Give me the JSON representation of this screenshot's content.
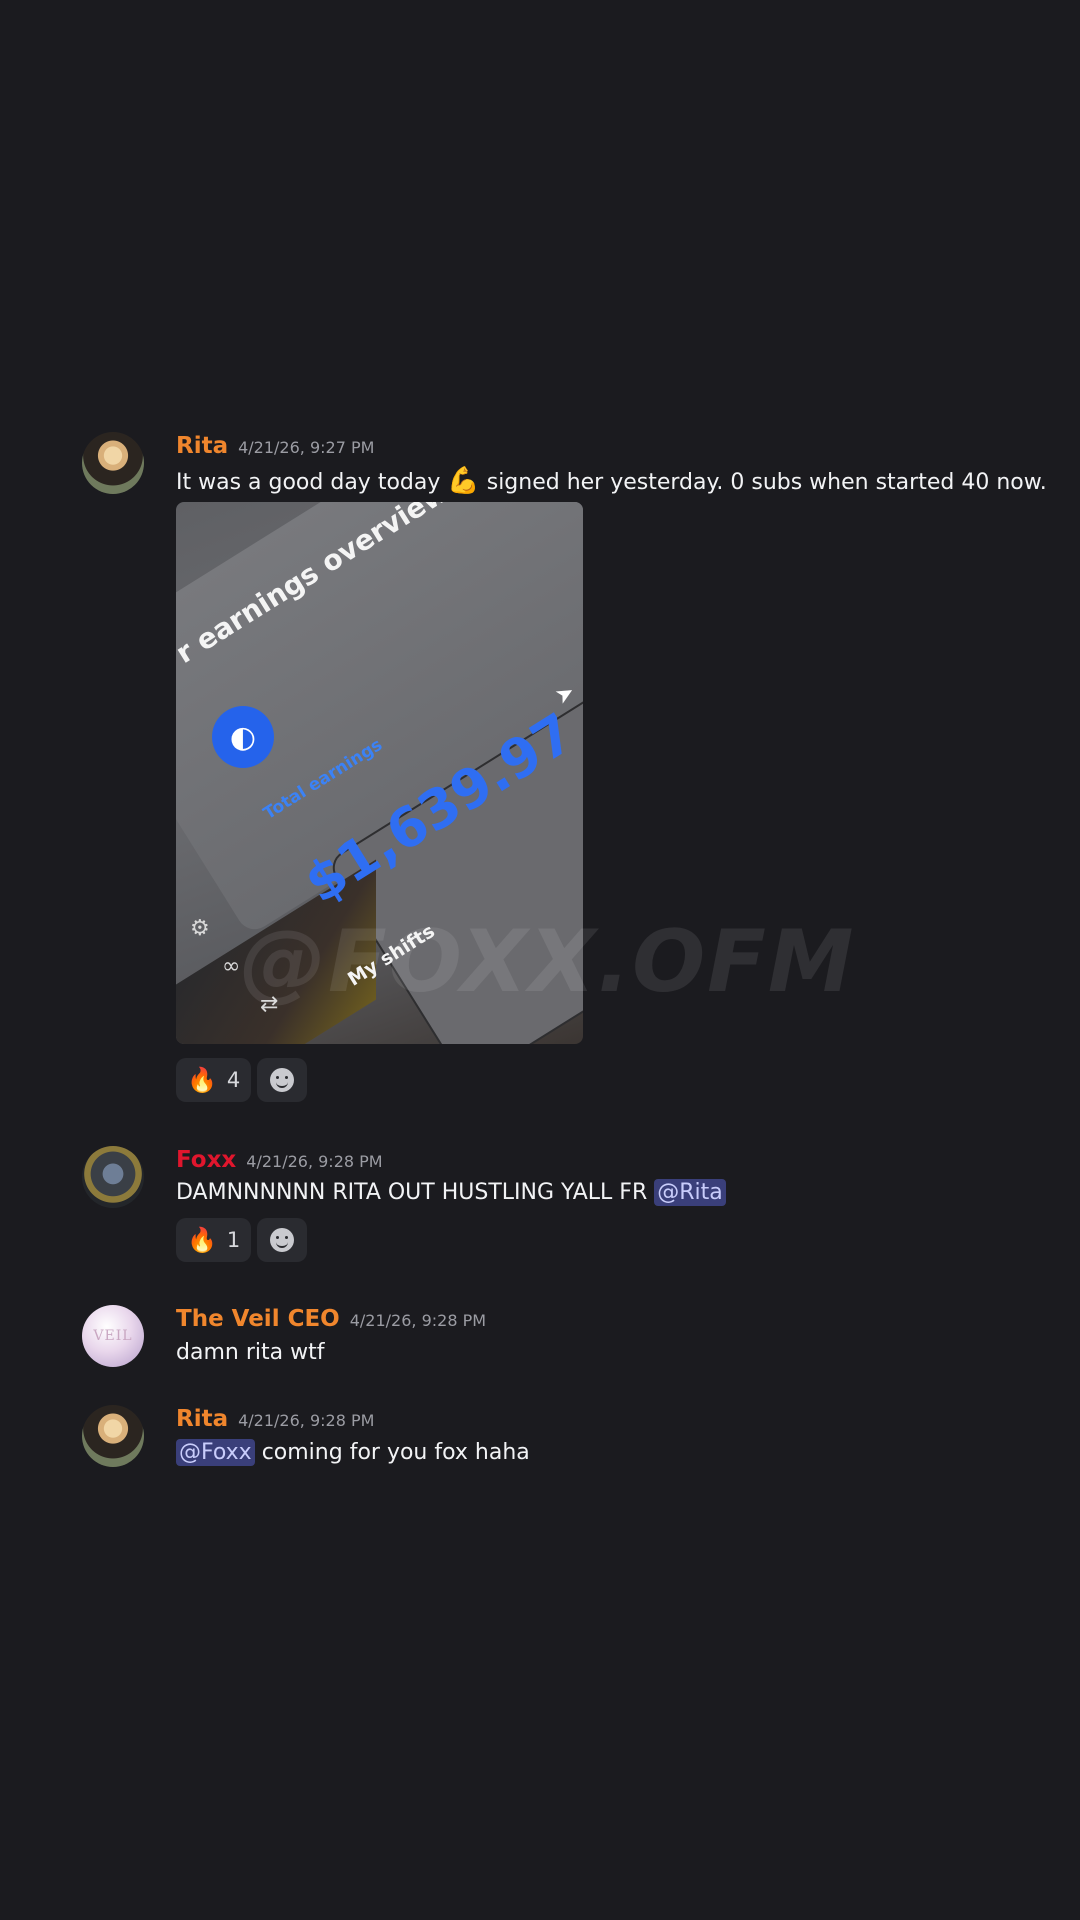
{
  "messages": [
    {
      "author": "Rita",
      "timestamp": "4/21/26, 9:27 PM",
      "text_before": "It was a good day today ",
      "emoji": "💪",
      "text_after": " signed her yesterday. 0 subs when started 40 now.",
      "attachment": {
        "title": "r earnings overview",
        "total_label": "Total earnings",
        "total_value": "$1,639.97",
        "shifts_label": "My shifts"
      },
      "reactions": [
        {
          "emoji": "🔥",
          "count": "4"
        }
      ]
    },
    {
      "author": "Foxx",
      "timestamp": "4/21/26, 9:28 PM",
      "text": "DAMNNNNNN RITA OUT HUSTLING YALL FR ",
      "mention": "@Rita",
      "reactions": [
        {
          "emoji": "🔥",
          "count": "1"
        }
      ]
    },
    {
      "author": "The Veil CEO",
      "avatar_text": "VEIL",
      "timestamp": "4/21/26, 9:28 PM",
      "text": "damn rita wtf"
    },
    {
      "author": "Rita",
      "timestamp": "4/21/26, 9:28 PM",
      "mention": "@Foxx",
      "text": " coming for you fox haha"
    }
  ],
  "watermark": "@FOXX.OFM",
  "colors": {
    "background": "#1b1b1f",
    "rita_name": "#f0862d",
    "foxx_name": "#e0162d",
    "mention_bg": "#3a3f7a"
  }
}
